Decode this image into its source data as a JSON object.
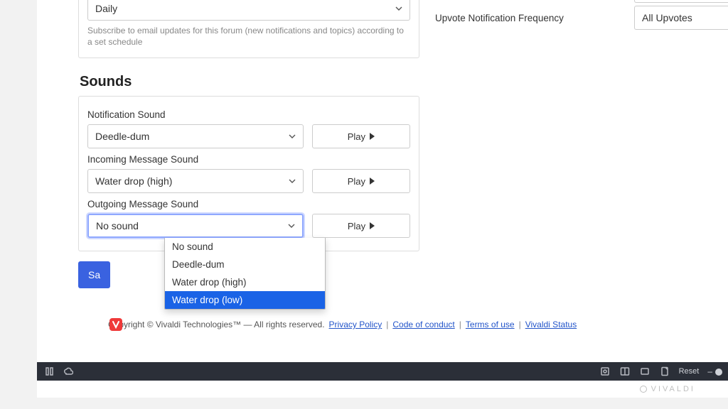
{
  "digest": {
    "selected": "Daily",
    "help": "Subscribe to email updates for this forum (new notifications and topics) according to a set schedule"
  },
  "sounds": {
    "title": "Sounds",
    "notification": {
      "label": "Notification Sound",
      "value": "Deedle-dum",
      "play": "Play"
    },
    "incoming": {
      "label": "Incoming Message Sound",
      "value": "Water drop (high)",
      "play": "Play"
    },
    "outgoing": {
      "label": "Outgoing Message Sound",
      "value": "No sound",
      "play": "Play",
      "options": [
        "No sound",
        "Deedle-dum",
        "Water drop (high)",
        "Water drop (low)"
      ],
      "highlight_index": 3
    }
  },
  "save": {
    "label_fragment": "Sa"
  },
  "right": {
    "upvote_label": "Upvote Notification Frequency",
    "upvote_value": "All Upvotes"
  },
  "footer": {
    "copyright": "Copyright © Vivaldi Technologies™ — All rights reserved.",
    "links": [
      "Privacy Policy",
      "Code of conduct",
      "Terms of use",
      "Vivaldi Status"
    ]
  },
  "statusbar": {
    "reset": "Reset"
  },
  "brand": "VIVALDI"
}
